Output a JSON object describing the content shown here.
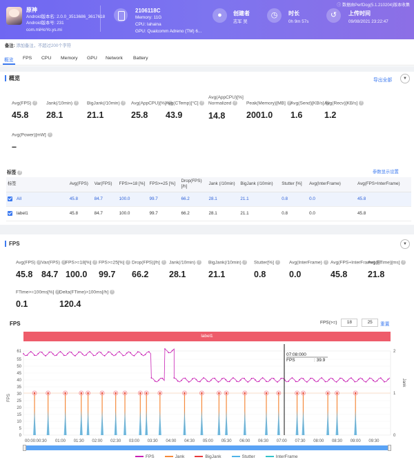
{
  "header": {
    "app_name": "原神",
    "app_version": "Android版本名: 2.0.0_3513686_3617618",
    "app_code": "Android版本号: 231",
    "package": "com.miHoYo.ys.mi",
    "device_name": "2106118C",
    "memory": "Memory: 11G",
    "cpu": "CPU: lahaina",
    "gpu": "GPU: Qualcomm Adreno (TM) 6...",
    "creator_label": "创建者",
    "creator_value": "志军 吴",
    "duration_label": "时长",
    "duration_value": "0h 9m 57s",
    "upload_label": "上传时间",
    "upload_value": "09/08/2021 23:22:47",
    "credit": "数据由PerfDog(5.1.210204)版本收集"
  },
  "remark": {
    "label": "备注:",
    "placeholder": "添加备注，不超过200个字符"
  },
  "tabs": [
    "概览",
    "FPS",
    "CPU",
    "Memory",
    "GPU",
    "Network",
    "Battery"
  ],
  "overview": {
    "title": "概览",
    "export": "导出全部",
    "stats": [
      {
        "label": "Avg(FPS)",
        "value": "45.8"
      },
      {
        "label": "Jank(/10min)",
        "value": "28.1"
      },
      {
        "label": "BigJank(/10min)",
        "value": "21.1"
      },
      {
        "label": "Avg(AppCPU)[%]",
        "value": "25.8"
      },
      {
        "label": "Avg(CTemp)[°C]",
        "value": "43.9"
      },
      {
        "label": "Avg(AppCPU)[%] Normalized",
        "value": "14.8"
      },
      {
        "label": "Peak(Memory)[MB]",
        "value": "2001.0"
      },
      {
        "label": "Avg(Send)[KB/s]",
        "value": "1.6"
      },
      {
        "label": "Avg(Recv)[KB/s]",
        "value": "1.2"
      },
      {
        "label": "Avg(Power)[mW]",
        "value": "–"
      }
    ],
    "tag_label": "标签",
    "param_link": "参数显示设置",
    "table": {
      "headers": [
        "标签",
        "Avg(FPS)",
        "Var(FPS)",
        "FPS>=18 [%]",
        "FPS>=25 [%]",
        "Drop(FPS) [/h]",
        "Jank (/10min)",
        "BigJank (/10min)",
        "Stutter [%]",
        "Avg(InterFrame)",
        "Avg(FPS+InterFrame)"
      ],
      "rows": [
        [
          "All",
          "45.8",
          "84.7",
          "100.0",
          "99.7",
          "66.2",
          "28.1",
          "21.1",
          "0.8",
          "0.0",
          "45.8"
        ],
        [
          "label1",
          "45.8",
          "84.7",
          "100.0",
          "99.7",
          "66.2",
          "28.1",
          "21.1",
          "0.8",
          "0.0",
          "45.8"
        ]
      ]
    }
  },
  "fps_section": {
    "title": "FPS",
    "stats": [
      {
        "label": "Avg(FPS)",
        "value": "45.8"
      },
      {
        "label": "Var(FPS)",
        "value": "84.7"
      },
      {
        "label": "FPS>=18[%]",
        "value": "100.0"
      },
      {
        "label": "FPS>=25[%]",
        "value": "99.7"
      },
      {
        "label": "Drop(FPS)[/h]",
        "value": "66.2"
      },
      {
        "label": "Jank(/10min)",
        "value": "28.1"
      },
      {
        "label": "BigJank(/10min)",
        "value": "21.1"
      },
      {
        "label": "Stutter[%]",
        "value": "0.8"
      },
      {
        "label": "Avg(InterFrame)",
        "value": "0.0"
      },
      {
        "label": "Avg(FPS+InterFrame)",
        "value": "45.8"
      },
      {
        "label": "Avg(FTime)[ms]",
        "value": "21.8"
      },
      {
        "label": "FTime>=100ms[%]",
        "value": "0.1"
      },
      {
        "label": "Delta(FTime)>100ms[/h]",
        "value": "120.4"
      }
    ]
  },
  "chart": {
    "title": "FPS",
    "range_label": "FPS(>=)",
    "range_low": "18",
    "range_high": "25",
    "reset": "重置",
    "label_bar": "label1",
    "tooltip_time": "07:08:000",
    "tooltip_label": "FPS",
    "tooltip_value": ": 39.9",
    "left_axis_title": "FPS",
    "right_axis_title": "Jank",
    "y_ticks": [
      "61",
      "55",
      "50",
      "45",
      "40",
      "35",
      "30",
      "25",
      "20",
      "15",
      "10",
      "5",
      "0"
    ],
    "right_ticks": [
      "2",
      "1",
      "0"
    ],
    "x_ticks": [
      "00:00:00:30",
      "01:00",
      "01:30",
      "02:00",
      "02:30",
      "03:00",
      "03:30",
      "04:00",
      "04:30",
      "05:00",
      "05:30",
      "06:00",
      "06:30",
      "07:00",
      "07:30",
      "08:00",
      "08:30",
      "09:00",
      "09:30"
    ],
    "legend": [
      "FPS",
      "Jank",
      "BigJank",
      "Stutter",
      "InterFrame"
    ],
    "colors": {
      "fps": "#c81fb4",
      "jank": "#f5893a",
      "bigjank": "#e83a3a",
      "stutter": "#4fb3e8",
      "interframe": "#33c2c9"
    }
  },
  "chart_data": {
    "type": "line",
    "title": "FPS",
    "xlabel": "",
    "ylabel": "FPS",
    "ylim": [
      0,
      61
    ],
    "x_range_seconds": [
      0,
      597
    ],
    "series": [
      {
        "name": "FPS",
        "segments": [
          {
            "from": "00:00",
            "to": "03:28",
            "approx_value": 59
          },
          {
            "from": "03:28",
            "to": "03:50",
            "approx_value": 40
          },
          {
            "from": "03:50",
            "to": "04:05",
            "approx_value": 61
          },
          {
            "from": "04:05",
            "to": "09:57",
            "approx_value": 40
          }
        ]
      },
      {
        "name": "Jank",
        "approx_values": [
          1,
          1,
          1,
          1,
          1,
          1,
          1,
          1,
          1,
          1,
          1,
          1,
          1,
          1,
          1,
          1,
          1,
          1,
          1,
          1,
          1,
          1,
          1,
          1,
          1,
          1,
          1,
          1
        ]
      },
      {
        "name": "BigJank",
        "approx_values": [
          1,
          1,
          1,
          1,
          1,
          1,
          1,
          1,
          1,
          1,
          1,
          1,
          1,
          1,
          1,
          1,
          1,
          1,
          1,
          1,
          1
        ]
      }
    ]
  }
}
